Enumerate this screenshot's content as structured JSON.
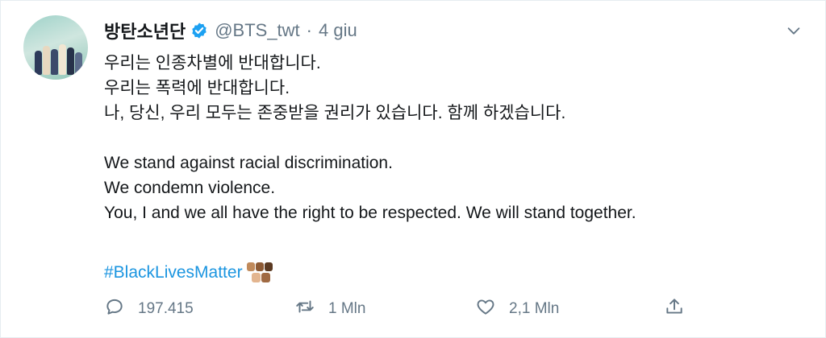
{
  "tweet": {
    "display_name": "방탄소년단",
    "handle": "@BTS_twt",
    "separator": "·",
    "timestamp": "4 giu",
    "verified": true,
    "text_lines": [
      "우리는 인종차별에 반대합니다.",
      "우리는 폭력에 반대합니다.",
      "나, 당신, 우리 모두는 존중받을 권리가 있습니다. 함께 하겠습니다.",
      "",
      "We stand against racial discrimination.",
      "We condemn violence.",
      "You, I and we all have the right to be respected. We will stand together."
    ],
    "hashtag": "#BlackLivesMatter",
    "hashtag_emoji": "raised-fist-emoji-trio"
  },
  "actions": {
    "reply": {
      "icon": "reply-icon",
      "count": "197.415"
    },
    "retweet": {
      "icon": "retweet-icon",
      "count": "1 Mln"
    },
    "like": {
      "icon": "heart-icon",
      "count": "2,1 Mln"
    },
    "share": {
      "icon": "share-icon"
    }
  },
  "colors": {
    "text": "#14171a",
    "secondary": "#657786",
    "link": "#1b95e0",
    "verified": "#1da1f2",
    "border": "#e6ecf0"
  }
}
